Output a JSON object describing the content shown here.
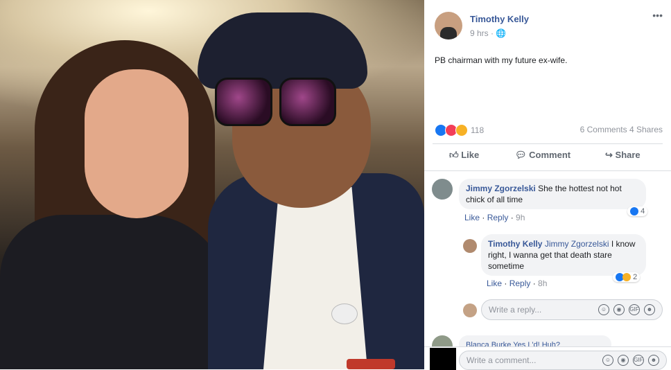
{
  "post": {
    "author": "Timothy Kelly",
    "time": "9 hrs",
    "text": "PB chairman with my future ex-wife.",
    "more": "•••",
    "reaction_count": "118",
    "comments_count": "6 Comments",
    "shares_count": "4 Shares"
  },
  "actions": {
    "like": "Like",
    "comment": "Comment",
    "share": "Share"
  },
  "comments": [
    {
      "author": "Jimmy Zgorzelski",
      "text": "She the hottest not hot chick of all time",
      "like": "Like",
      "reply": "Reply",
      "time": "9h",
      "reactions": "4"
    }
  ],
  "reply": {
    "author": "Timothy Kelly",
    "mention": "Jimmy Zgorzelski",
    "text": "I know right, I wanna get that death stare sometime",
    "like": "Like",
    "reply": "Reply",
    "time": "8h",
    "reactions": "2"
  },
  "inputs": {
    "reply_placeholder": "Write a reply...",
    "comment_placeholder": "Write a comment...",
    "gif": "GIF"
  },
  "partial_comment": "Blanca Burke  Yes I 'd! Huh? ",
  "colors": {
    "link": "#385898",
    "like_blue": "#1877f2",
    "love_red": "#f33e58",
    "haha_yellow": "#f7b125"
  },
  "icons": [
    "lens-search-icon",
    "share-icon",
    "thumbs-up-icon",
    "comment-icon",
    "share-arrow-icon",
    "globe-icon",
    "emoji-icon",
    "camera-icon",
    "gif-icon",
    "sticker-icon"
  ]
}
